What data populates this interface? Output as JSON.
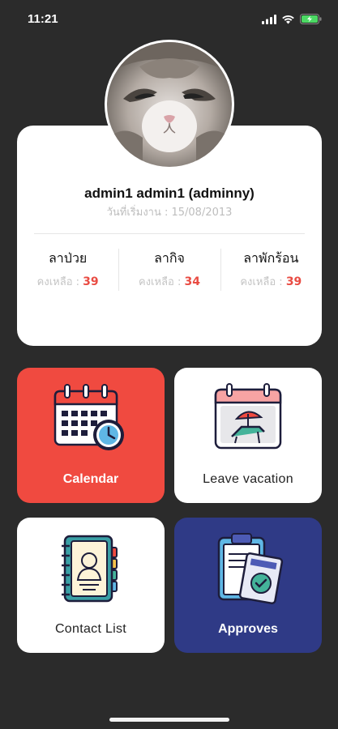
{
  "status_bar": {
    "time": "11:21",
    "icons": [
      "signal-icon",
      "wifi-icon",
      "battery-charging-icon"
    ],
    "battery_color": "#4cd964"
  },
  "profile": {
    "name": "admin1 admin1 (adminny)",
    "start_date_label": "วันที่เริ่มงาน : 15/08/2013",
    "avatar": "cat-photo"
  },
  "leave_stats": [
    {
      "label": "ลาป่วย",
      "remain_label": "คงเหลือ :",
      "remain_value": "39"
    },
    {
      "label": "ลากิจ",
      "remain_label": "คงเหลือ :",
      "remain_value": "34"
    },
    {
      "label": "ลาพักร้อน",
      "remain_label": "คงเหลือ :",
      "remain_value": "39"
    }
  ],
  "menu": {
    "calendar": {
      "label": "Calendar",
      "icon": "calendar-clock-icon",
      "bg": "#f04a40"
    },
    "leave_vacation": {
      "label": "Leave vacation",
      "icon": "beach-calendar-icon",
      "bg": "#ffffff"
    },
    "contact_list": {
      "label": "Contact List",
      "icon": "contact-book-icon",
      "bg": "#ffffff"
    },
    "approves": {
      "label": "Approves",
      "icon": "clipboard-check-icon",
      "bg": "#2f3a86"
    }
  },
  "colors": {
    "background": "#2b2b2b",
    "accent_red": "#e94c43",
    "approves_blue": "#2f3a86"
  }
}
